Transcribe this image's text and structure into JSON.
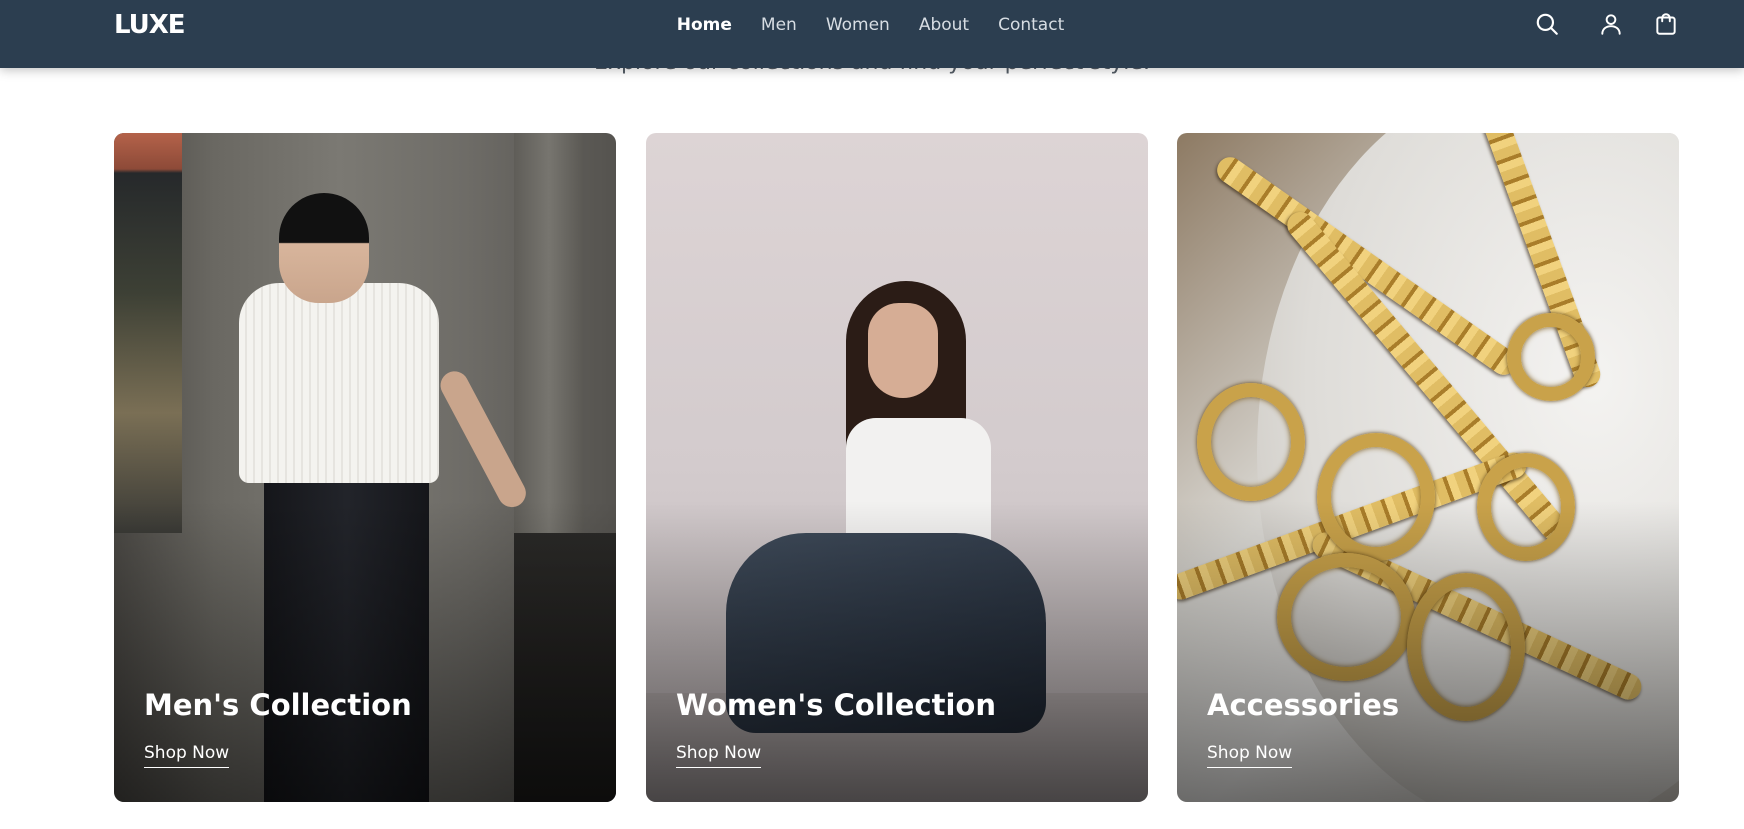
{
  "header": {
    "logo": "LUXE",
    "nav": [
      {
        "label": "Home",
        "active": true
      },
      {
        "label": "Men",
        "active": false
      },
      {
        "label": "Women",
        "active": false
      },
      {
        "label": "About",
        "active": false
      },
      {
        "label": "Contact",
        "active": false
      }
    ],
    "icons": [
      "search-icon",
      "user-icon",
      "shopping-bag-icon"
    ],
    "background_color": "#2c3e50"
  },
  "section": {
    "subtitle": "Explore our collections and find your perfect style."
  },
  "collections": [
    {
      "title": "Men's Collection",
      "link_label": "Shop Now"
    },
    {
      "title": "Women's Collection",
      "link_label": "Shop Now"
    },
    {
      "title": "Accessories",
      "link_label": "Shop Now"
    }
  ]
}
